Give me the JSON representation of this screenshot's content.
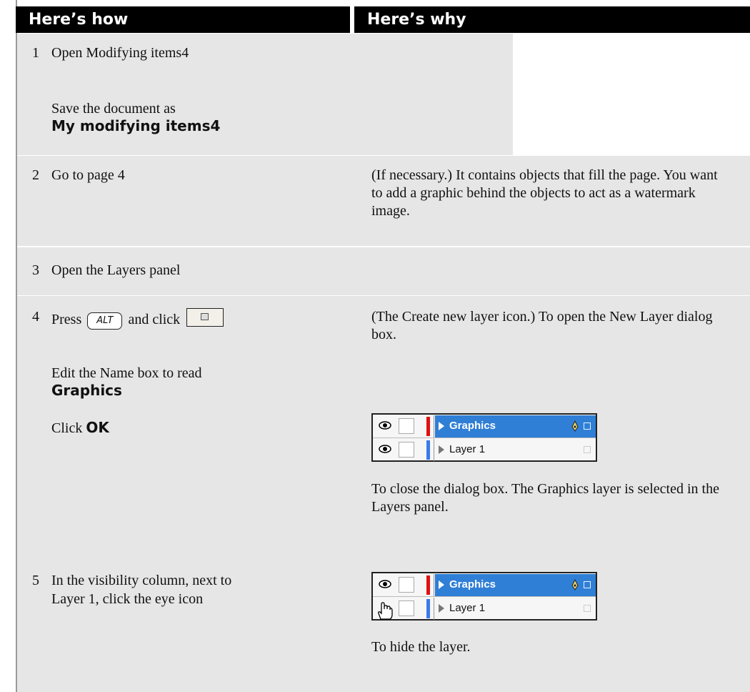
{
  "header": {
    "how": "Here’s how",
    "why": "Here’s why"
  },
  "steps": [
    {
      "num": "1",
      "how": "Open Modifying items4",
      "why": ""
    },
    {
      "num": "",
      "how_prefix": "Save the document as",
      "how_bold": "My modifying items4",
      "why": ""
    },
    {
      "num": "2",
      "how": "Go to page 4",
      "why": "(If necessary.) It contains objects that fill the page. You want to add a graphic behind the objects to act as a watermark image."
    },
    {
      "num": "3",
      "how": "Open the Layers panel",
      "why": ""
    },
    {
      "num": "4",
      "how_prefix": "Press",
      "key": "ALT",
      "how_mid": "and click",
      "why": "(The Create new layer icon.) To open the New Layer dialog box."
    },
    {
      "num": "",
      "how_prefix": "Edit the Name box to read",
      "how_bold": "Graphics",
      "why": ""
    },
    {
      "num": "",
      "how_prefix": "Click",
      "how_bold": "OK",
      "why": "To close the dialog box. The Graphics layer is selected in the Layers panel."
    },
    {
      "num": "5",
      "how_line1": "In the visibility column, next to",
      "how_line2": "Layer 1, click the eye icon",
      "why": "To hide the layer."
    }
  ],
  "layers_panel": {
    "rows": [
      {
        "name": "Graphics",
        "color": "#e01010",
        "selected": true
      },
      {
        "name": "Layer 1",
        "color": "#3b7be8",
        "selected": false
      }
    ]
  },
  "icons": [
    "eye-icon",
    "pen-icon",
    "hand-cursor-icon",
    "new-layer-icon"
  ]
}
